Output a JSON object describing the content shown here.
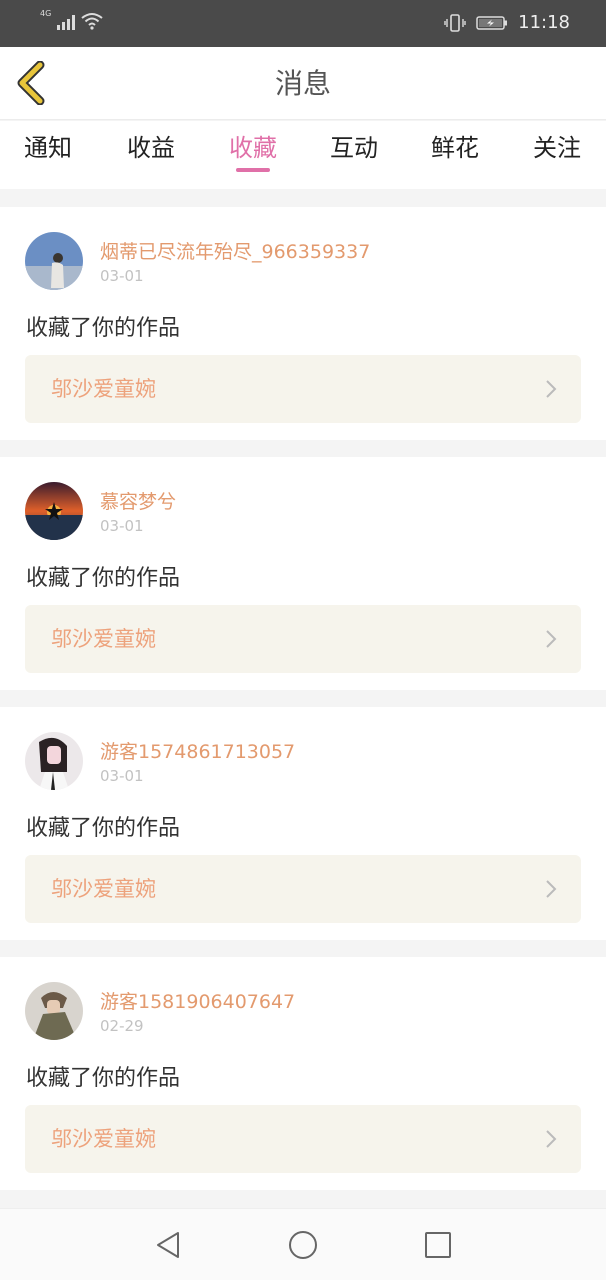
{
  "status_bar": {
    "network": "4G",
    "time": "11:18",
    "icons": [
      "signal-icon",
      "wifi-icon",
      "vibrate-icon",
      "battery-icon"
    ]
  },
  "header": {
    "title": "消息",
    "back_icon": "chevron-left-icon"
  },
  "tabs": [
    {
      "label": "通知",
      "active": false
    },
    {
      "label": "收益",
      "active": false
    },
    {
      "label": "收藏",
      "active": true
    },
    {
      "label": "互动",
      "active": false
    },
    {
      "label": "鲜花",
      "active": false
    },
    {
      "label": "关注",
      "active": false
    }
  ],
  "messages": [
    {
      "user": "烟蒂已尽流年殆尽_966359337",
      "date": "03-01",
      "action": "收藏了你的作品",
      "work": "邬沙爱童婉"
    },
    {
      "user": "慕容梦兮",
      "date": "03-01",
      "action": "收藏了你的作品",
      "work": "邬沙爱童婉"
    },
    {
      "user": "游客1574861713057",
      "date": "03-01",
      "action": "收藏了你的作品",
      "work": "邬沙爱童婉"
    },
    {
      "user": "游客1581906407647",
      "date": "02-29",
      "action": "收藏了你的作品",
      "work": "邬沙爱童婉"
    }
  ],
  "colors": {
    "accent": "#e070a8",
    "username": "#e39a6e",
    "work_title": "#eda27c",
    "work_box": "#f6f4ec",
    "back_arrow": "#c9a227"
  },
  "navbar": {
    "icons": [
      "back-triangle-icon",
      "home-circle-icon",
      "recents-square-icon"
    ]
  }
}
